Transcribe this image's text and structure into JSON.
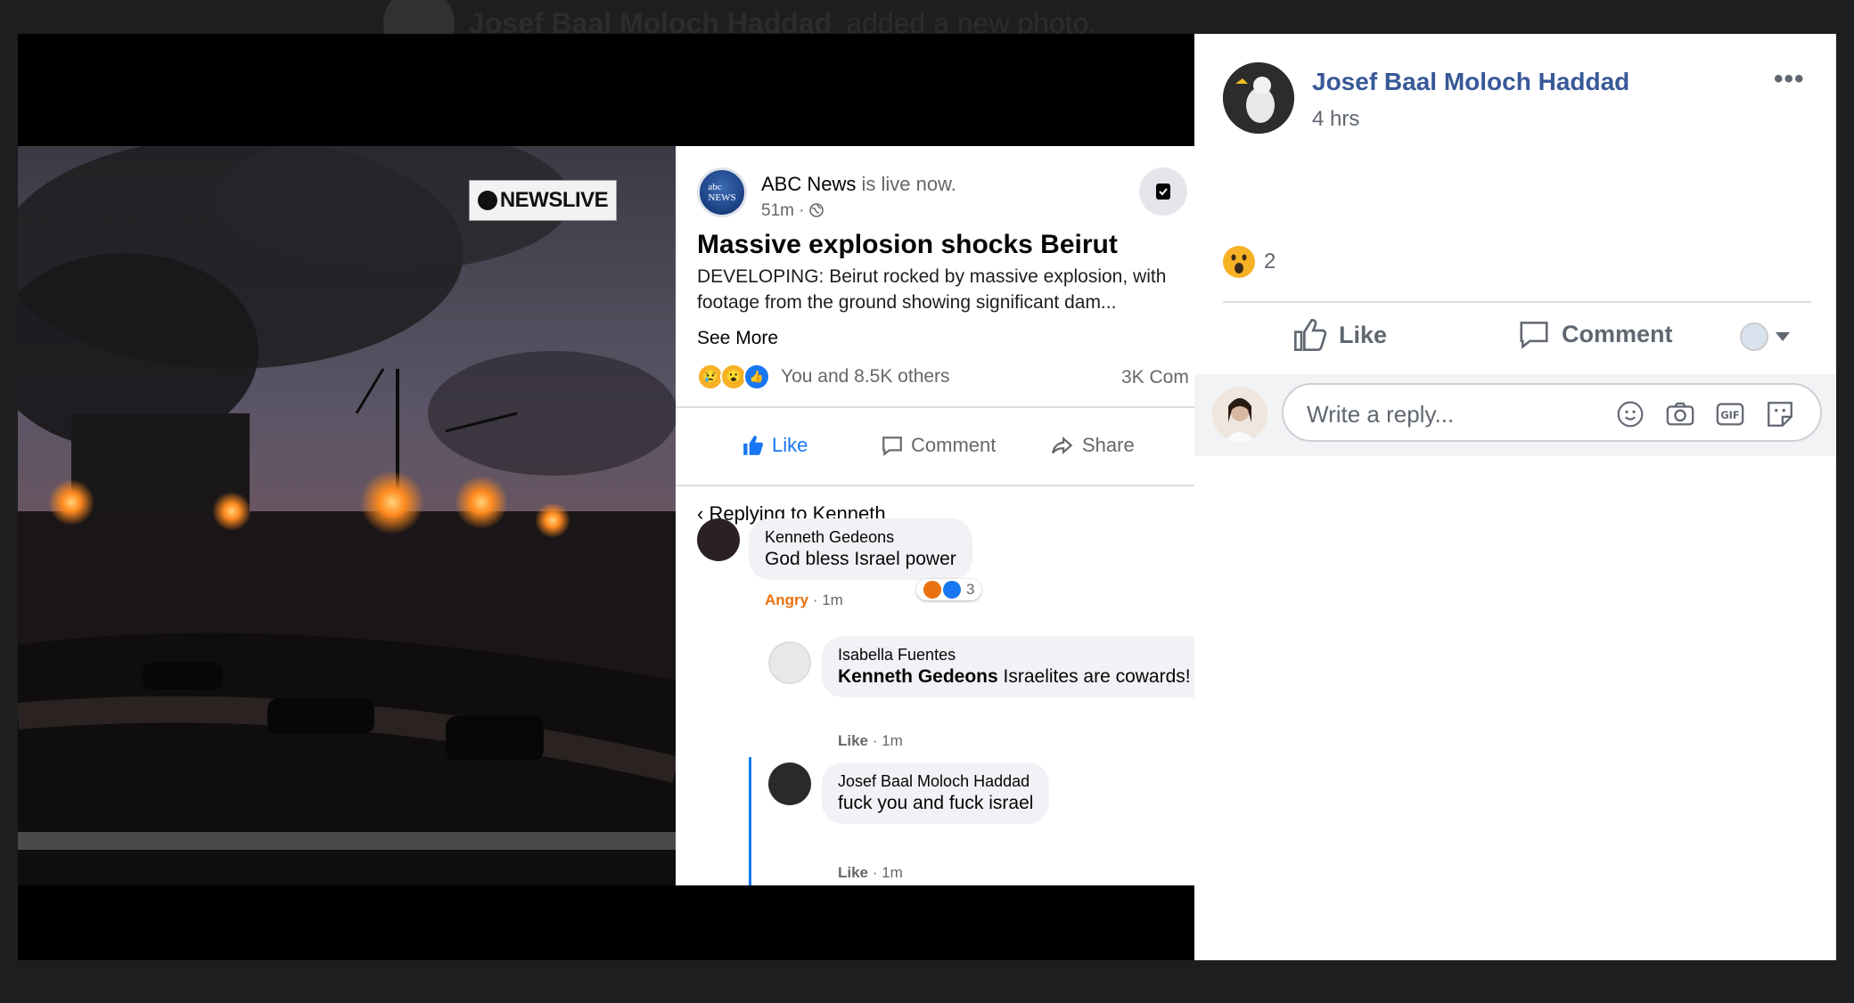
{
  "background_post": {
    "author": "Josef Baal Moloch Haddad",
    "action": "added a new photo.",
    "time": "4h"
  },
  "screenshot": {
    "news_logo": "NEWSLIVE",
    "page_name": "ABC News",
    "live_text": "is live now.",
    "meta": "51m ·",
    "headline": "Massive explosion shocks Beirut",
    "description": "DEVELOPING: Beirut rocked by massive explosion, with footage from the ground showing significant dam...",
    "see_more": "See More",
    "reactions_text": "You and 8.5K others",
    "comments_count": "3K Com",
    "actions": {
      "like": "Like",
      "comment": "Comment",
      "share": "Share"
    },
    "replying_to": "Replying to Kenneth",
    "comments": [
      {
        "name": "Kenneth Gedeons",
        "text": "God bless Israel power",
        "reaction_label": "Angry",
        "meta": " · 1m",
        "reaction_count": "3"
      },
      {
        "name": "Isabella Fuentes",
        "mention": "Kenneth Gedeons",
        "text": " Israelites are cowards!",
        "like": "Like",
        "meta": " · 1m"
      },
      {
        "name": "Josef Baal Moloch Haddad",
        "text": "fuck you and fuck israel",
        "like": "Like",
        "meta": " · 1m"
      }
    ]
  },
  "sidebar": {
    "author": "Josef Baal Moloch Haddad",
    "time": "4 hrs",
    "more": "•••",
    "wow_count": "2",
    "like_label": "Like",
    "comment_label": "Comment",
    "reply_placeholder": "Write a reply...",
    "accent": "#385898"
  }
}
